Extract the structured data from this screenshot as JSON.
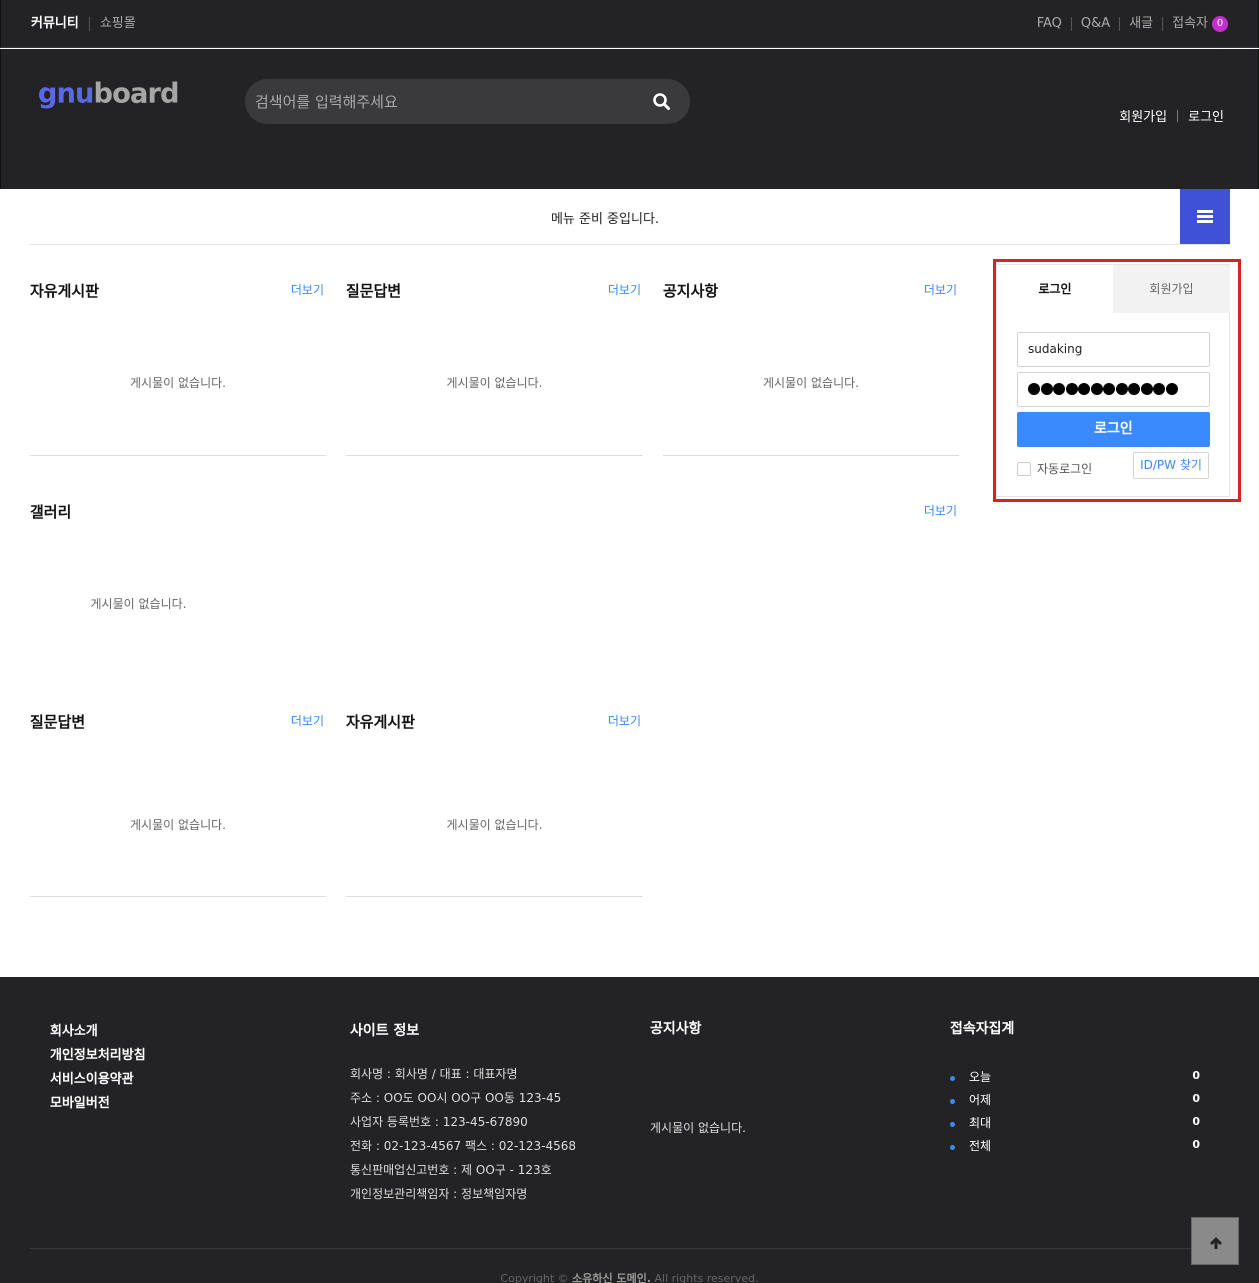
{
  "tnb": {
    "community": "커뮤니티",
    "shop": "쇼핑몰",
    "faq": "FAQ",
    "qa": "Q&A",
    "new": "새글",
    "visitors": "접속자",
    "visitors_count": "0"
  },
  "header": {
    "logo_text": "gnuboard",
    "search_placeholder": "검색어를 입력해주세요",
    "join": "회원가입",
    "login": "로그인"
  },
  "gnb": {
    "message": "메뉴 준비 중입니다."
  },
  "boards": {
    "free": {
      "title": "자유게시판",
      "more": "더보기",
      "empty": "게시물이 없습니다."
    },
    "qa": {
      "title": "질문답변",
      "more": "더보기",
      "empty": "게시물이 없습니다."
    },
    "notice": {
      "title": "공지사항",
      "more": "더보기",
      "empty": "게시물이 없습니다."
    },
    "gallery": {
      "title": "갤러리",
      "more": "더보기",
      "empty": "게시물이 없습니다."
    },
    "qa2": {
      "title": "질문답변",
      "more": "더보기",
      "empty": "게시물이 없습니다."
    },
    "free2": {
      "title": "자유게시판",
      "more": "더보기",
      "empty": "게시물이 없습니다."
    }
  },
  "login_box": {
    "tab_login": "로그인",
    "tab_join": "회원가입",
    "user_id": "sudaking",
    "password_mask_count": 12,
    "login_button": "로그인",
    "auto_login": "자동로그인",
    "find": "ID/PW 찾기"
  },
  "footer": {
    "links": [
      "회사소개",
      "개인정보처리방침",
      "서비스이용약관",
      "모바일버전"
    ],
    "site_info_title": "사이트 정보",
    "site_info": [
      "회사명 : 회사명 / 대표 : 대표자명",
      "주소 : OO도 OO시 OO구 OO동 123-45",
      "사업자 등록번호 : 123-45-67890",
      "전화 : 02-123-4567  팩스 : 02-123-4568",
      "통신판매업신고번호 : 제 OO구 - 123호",
      "개인정보관리책임자 : 정보책임자명"
    ],
    "notice_title": "공지사항",
    "notice_empty": "게시물이 없습니다.",
    "visit_title": "접속자집계",
    "visit": [
      {
        "label": "오늘",
        "value": "0"
      },
      {
        "label": "어제",
        "value": "0"
      },
      {
        "label": "최대",
        "value": "0"
      },
      {
        "label": "전체",
        "value": "0"
      }
    ],
    "copyright_prefix": "Copyright © ",
    "copyright_domain": "소유하신 도메인.",
    "copyright_suffix": " All rights reserved."
  },
  "colors": {
    "dark_bg": "#232325",
    "accent_blue": "#3a8afd",
    "menu_button": "#3f51d6",
    "badge": "#c32fd1",
    "highlight": "#d9231d"
  }
}
